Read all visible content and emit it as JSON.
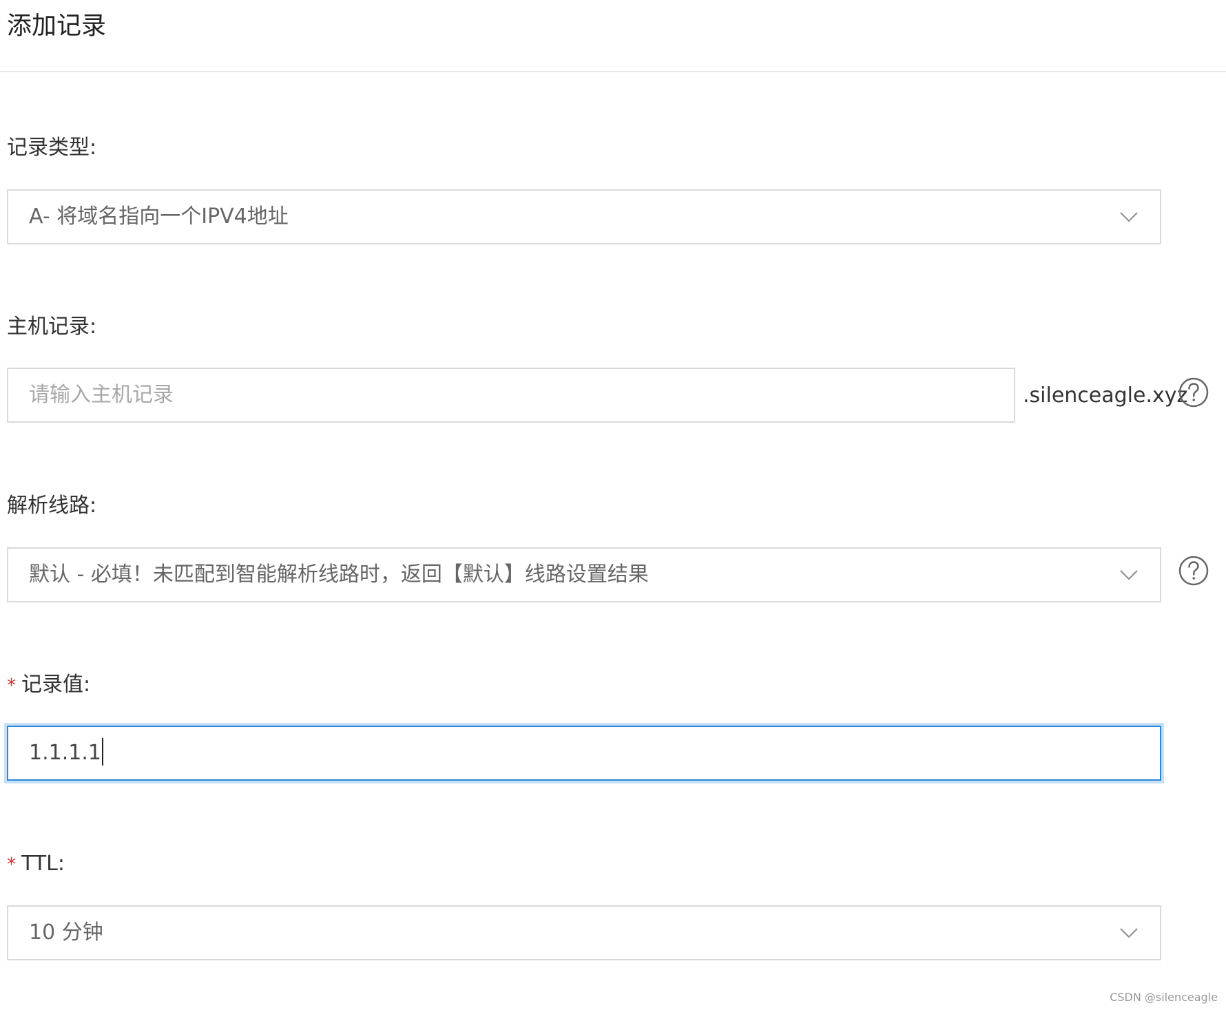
{
  "header": {
    "title": "添加记录"
  },
  "form": {
    "record_type": {
      "label": "记录类型:",
      "value": "A- 将域名指向一个IPV4地址",
      "icon": "chevron-down-icon"
    },
    "host_record": {
      "label": "主机记录:",
      "placeholder": "请输入主机记录",
      "suffix": ".silenceagle.xyz",
      "help_icon": "question-circle-icon"
    },
    "resolution_line": {
      "label": "解析线路:",
      "value": "默认 - 必填！未匹配到智能解析线路时，返回【默认】线路设置结果",
      "icon": "chevron-down-icon",
      "help_icon": "question-circle-icon"
    },
    "record_value": {
      "required_mark": "*",
      "label": "记录值:",
      "value": "1.1.1.1"
    },
    "ttl": {
      "required_mark": "*",
      "label": "TTL:",
      "value": "10 分钟",
      "icon": "chevron-down-icon"
    }
  },
  "watermark": "CSDN @silenceagle",
  "colors": {
    "required": "#d9322e",
    "focus_border": "#2d86d9",
    "focus_glow": "#c8e0f6",
    "field_border": "#d9d9d9"
  }
}
